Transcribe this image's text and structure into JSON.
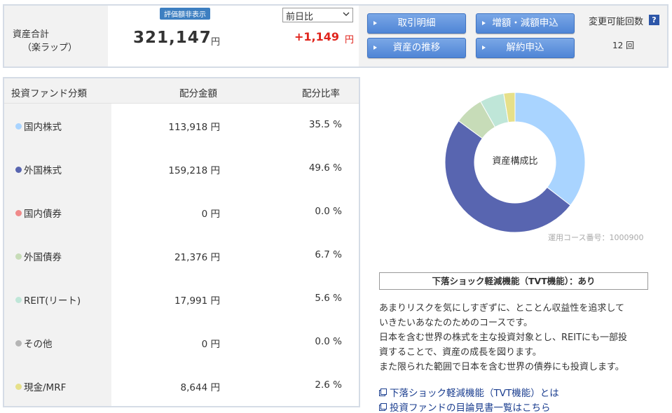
{
  "summary": {
    "label_line1": "資産合計",
    "label_line2": "（楽ラップ）",
    "badge": "評価額非表示",
    "total_amount": "321,147",
    "total_unit": "円",
    "compare_selected": "前日比",
    "diff_amount": "+1,149",
    "diff_unit": "円",
    "buttons": {
      "details": "取引明細",
      "increase": "増額・減額申込",
      "history": "資産の推移",
      "cancel": "解約申込"
    },
    "change_title": "変更可能回数",
    "help": "?",
    "change_count": "12 回"
  },
  "table": {
    "headers": {
      "category": "投資ファンド分類",
      "amount": "配分金額",
      "ratio": "配分比率"
    },
    "rows": [
      {
        "category": "国内株式",
        "amount": "113,918 円",
        "ratio": "35.5 %",
        "color": "#a9d4ff"
      },
      {
        "category": "外国株式",
        "amount": "159,218 円",
        "ratio": "49.6 %",
        "color": "#5865b0"
      },
      {
        "category": "国内債券",
        "amount": "0 円",
        "ratio": "0.0 %",
        "color": "#f08a8a"
      },
      {
        "category": "外国債券",
        "amount": "21,376 円",
        "ratio": "6.7 %",
        "color": "#c7dcb8"
      },
      {
        "category": "REIT(リート)",
        "amount": "17,991 円",
        "ratio": "5.6 %",
        "color": "#bfe6d8"
      },
      {
        "category": "その他",
        "amount": "0 円",
        "ratio": "0.0 %",
        "color": "#b5b5b5"
      },
      {
        "category": "現金/MRF",
        "amount": "8,644 円",
        "ratio": "2.6 %",
        "color": "#e6e08a"
      }
    ]
  },
  "chart_data": {
    "type": "pie",
    "title": "資産構成比",
    "categories": [
      "国内株式",
      "外国株式",
      "国内債券",
      "外国債券",
      "REIT(リート)",
      "その他",
      "現金/MRF"
    ],
    "values": [
      35.5,
      49.6,
      0.0,
      6.7,
      5.6,
      0.0,
      2.6
    ],
    "colors": [
      "#a9d4ff",
      "#5865b0",
      "#f08a8a",
      "#c7dcb8",
      "#bfe6d8",
      "#b5b5b5",
      "#e6e08a"
    ]
  },
  "course_number": "運用コース番号：1000900",
  "tvt_box": "下落ショック軽減機能（TVT機能）：あり",
  "description": [
    "あまりリスクを気にしすぎずに、とことん収益性を追求して",
    "いきたいあなたのためのコースです。",
    "日本を含む世界の株式を主な投資対象とし、REITにも一部投",
    "資することで、資産の成長を図ります。",
    "また限られた範囲で日本を含む世界の債券にも投資します。"
  ],
  "links": {
    "tvt": "下落ショック軽減機能（TVT機能）とは",
    "prospectus": "投資ファンドの目論見書一覧はこちら"
  }
}
